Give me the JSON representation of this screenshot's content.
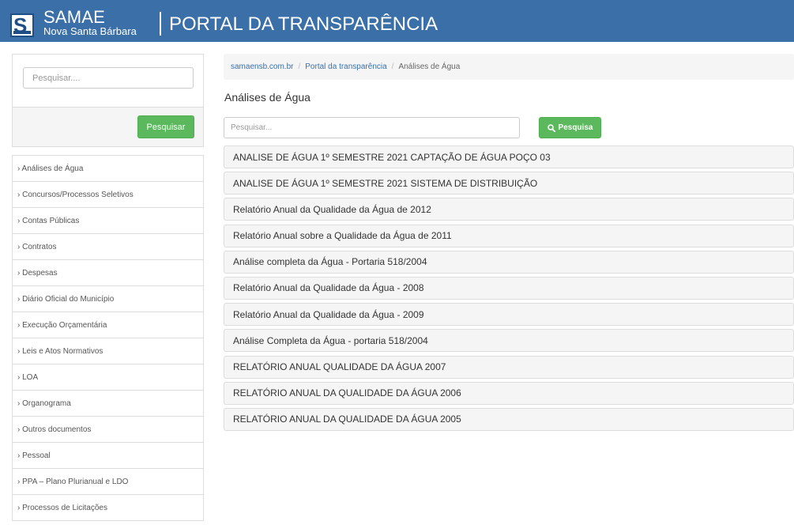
{
  "header": {
    "brand_name": "SAMAE",
    "brand_sub": "Nova Santa Bárbara",
    "portal_title": "PORTAL DA TRANSPARÊNCIA",
    "logo_letter": "S",
    "color": "#3b6fa8"
  },
  "sidebar": {
    "search_placeholder": "Pesquisar....",
    "search_button": "Pesquisar",
    "items": [
      "› Análises de Água",
      "› Concursos/Processos Seletivos",
      "› Contas Públicas",
      "› Contratos",
      "› Despesas",
      "› Diário Oficial do Município",
      "› Execução Orçamentária",
      "› Leis e Atos Normativos",
      "› LOA",
      "› Organograma",
      "› Outros documentos",
      "› Pessoal",
      "› PPA – Plano Plurianual e LDO",
      "› Processos de Licitações"
    ]
  },
  "breadcrumb": {
    "items": [
      "samaensb.com.br",
      "Portal da transparência",
      "Análises de Água"
    ],
    "separator": "/"
  },
  "main": {
    "title": "Análises de Água",
    "search_placeholder": "Pesquisar...",
    "search_button": "Pesquisa",
    "search_icon": "search-icon",
    "documents": [
      "ANALISE DE ÁGUA 1º SEMESTRE 2021 CAPTAÇÃO DE ÁGUA POÇO 03",
      "ANALISE DE ÁGUA 1º SEMESTRE 2021 SISTEMA DE DISTRIBUIÇÃO",
      "Relatório Anual da Qualidade da Água de 2012",
      "Relatório Anual sobre a Qualidade da Água de 2011",
      "Análise completa da Água - Portaria 518/2004",
      "Relatório Anual da Qualidade da Água - 2008",
      "Relatório Anual da Qualidade da Água - 2009",
      "Análise Completa da Água - portaria 518/2004",
      "RELATÓRIO ANUAL QUALIDADE DA ÁGUA 2007",
      "RELATÓRIO ANUAL DA QUALIDADE DA ÁGUA 2006",
      "RELATÓRIO ANUAL DA QUALIDADE DA ÁGUA 2005"
    ]
  },
  "colors": {
    "accent_green": "#5cb85c",
    "link_blue": "#3572b0"
  }
}
